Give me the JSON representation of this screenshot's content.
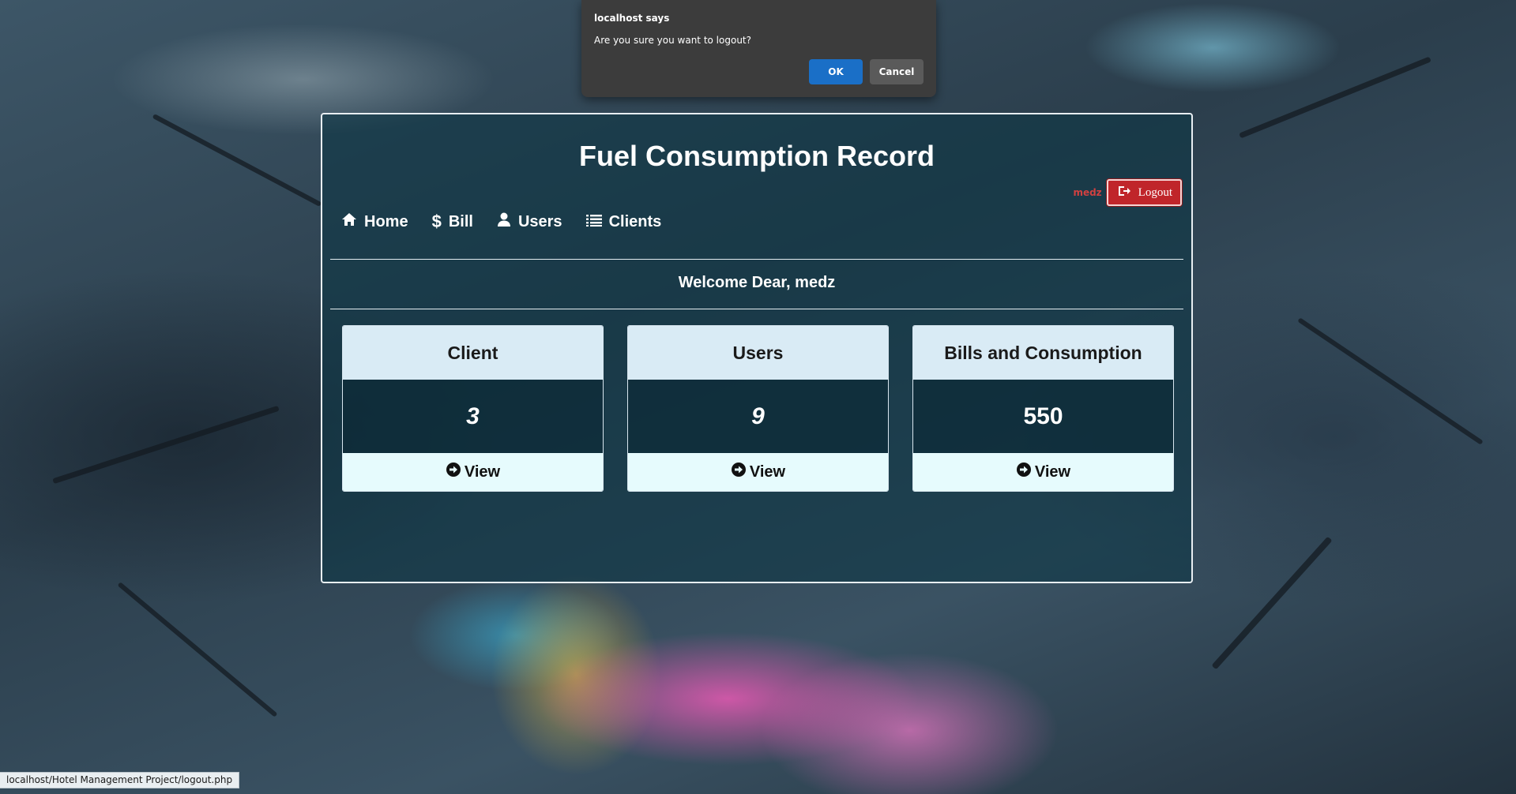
{
  "page": {
    "title": "Fuel Consumption Record",
    "username": "medz",
    "logout_label": "Logout",
    "welcome": "Welcome Dear, medz"
  },
  "nav": {
    "items": [
      {
        "label": "Home",
        "icon": "home-icon"
      },
      {
        "label": "Bill",
        "icon": "dollar-icon"
      },
      {
        "label": "Users",
        "icon": "user-icon"
      },
      {
        "label": "Clients",
        "icon": "list-icon"
      }
    ]
  },
  "cards": [
    {
      "title": "Client",
      "count": "3",
      "action": "View"
    },
    {
      "title": "Users",
      "count": "9",
      "action": "View"
    },
    {
      "title": "Bills and Consumption",
      "count": "550",
      "action": "View"
    }
  ],
  "dialog": {
    "title": "localhost says",
    "message": "Are you sure you want to logout?",
    "ok_label": "OK",
    "cancel_label": "Cancel"
  },
  "status_bar": {
    "url": "localhost/Hotel Management Project/logout.php"
  },
  "colors": {
    "logout_button": "#c0252a",
    "username_text": "#d14040",
    "card_header": "#d9ebf5",
    "card_footer": "#e6fbfd",
    "dialog_ok": "#1a6fc7",
    "dialog_bg": "#3c3c3c"
  }
}
